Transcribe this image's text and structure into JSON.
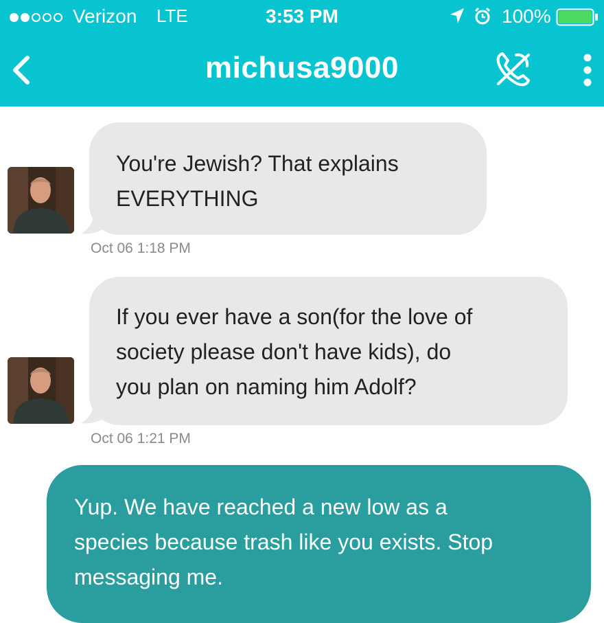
{
  "status_bar": {
    "carrier": "Verizon",
    "network": "LTE",
    "time": "3:53 PM",
    "battery": "100%",
    "signal_filled": 2,
    "signal_total": 5
  },
  "header": {
    "title": "michusa9000",
    "back_icon": "chevron-left-icon",
    "call_icon": "phone-call-icon",
    "more_icon": "more-vertical-icon",
    "accent": "#08c4d0"
  },
  "messages": [
    {
      "direction": "incoming",
      "lines": [
        "You're Jewish?  That explains",
        "EVERYTHING"
      ],
      "timestamp": "Oct 06 1:18 PM"
    },
    {
      "direction": "incoming",
      "lines": [
        "If you ever have a son(for the love of",
        "society please don't have kids), do",
        "you plan on naming him Adolf?"
      ],
      "timestamp": "Oct 06 1:21 PM"
    },
    {
      "direction": "outgoing",
      "lines": [
        "Yup. We have reached a new low as a",
        "species because trash like you exists. Stop",
        "messaging me."
      ]
    }
  ],
  "colors": {
    "incoming_bubble": "#e8e8e8",
    "outgoing_bubble": "#2a9d9e",
    "timestamp": "#8a8a8a"
  }
}
